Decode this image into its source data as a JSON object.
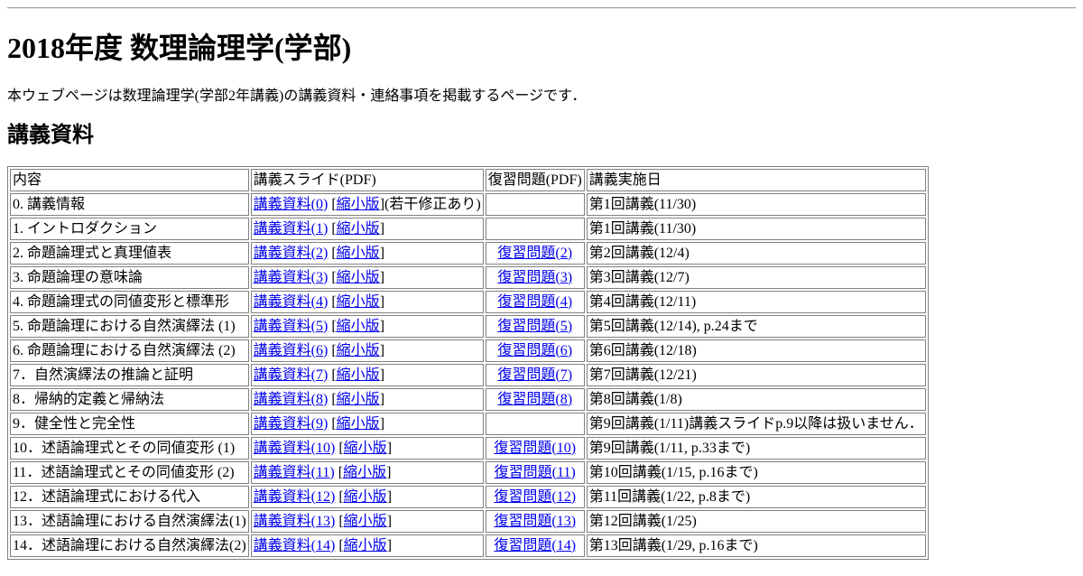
{
  "page": {
    "title": "2018年度 数理論理学(学部)",
    "intro": "本ウェブページは数理論理学(学部2年講義)の講義資料・連絡事項を掲載するページです．",
    "section_heading": "講義資料"
  },
  "table": {
    "headers": [
      "内容",
      "講義スライド(PDF)",
      "復習問題(PDF)",
      "講義実施日"
    ],
    "rows": [
      {
        "content": "0. 講義情報",
        "slide": "講義資料(0)",
        "small": "縮小版",
        "note": "(若干修正あり)",
        "review": "",
        "date": "第1回講義(11/30)"
      },
      {
        "content": "1. イントロダクション",
        "slide": "講義資料(1)",
        "small": "縮小版",
        "note": "",
        "review": "",
        "date": "第1回講義(11/30)"
      },
      {
        "content": "2. 命題論理式と真理値表",
        "slide": "講義資料(2)",
        "small": "縮小版",
        "note": "",
        "review": "復習問題(2)",
        "date": "第2回講義(12/4)"
      },
      {
        "content": "3. 命題論理の意味論",
        "slide": "講義資料(3)",
        "small": "縮小版",
        "note": "",
        "review": "復習問題(3)",
        "date": "第3回講義(12/7)"
      },
      {
        "content": "4. 命題論理式の同値変形と標準形",
        "slide": "講義資料(4)",
        "small": "縮小版",
        "note": "",
        "review": "復習問題(4)",
        "date": "第4回講義(12/11)"
      },
      {
        "content": "5. 命題論理における自然演繹法 (1)",
        "slide": "講義資料(5)",
        "small": "縮小版",
        "note": "",
        "review": "復習問題(5)",
        "date": "第5回講義(12/14), p.24まで"
      },
      {
        "content": "6. 命題論理における自然演繹法 (2)",
        "slide": "講義資料(6)",
        "small": "縮小版",
        "note": "",
        "review": "復習問題(6)",
        "date": "第6回講義(12/18)"
      },
      {
        "content": "7．自然演繹法の推論と証明",
        "slide": "講義資料(7)",
        "small": "縮小版",
        "note": "",
        "review": "復習問題(7)",
        "date": "第7回講義(12/21)"
      },
      {
        "content": "8．帰納的定義と帰納法",
        "slide": "講義資料(8)",
        "small": "縮小版",
        "note": "",
        "review": "復習問題(8)",
        "date": "第8回講義(1/8)"
      },
      {
        "content": "9．健全性と完全性",
        "slide": "講義資料(9)",
        "small": "縮小版",
        "note": "",
        "review": "",
        "date": "第9回講義(1/11)講義スライドp.9以降は扱いません．"
      },
      {
        "content": "10．述語論理式とその同値変形 (1)",
        "slide": "講義資料(10)",
        "small": "縮小版",
        "note": "",
        "review": "復習問題(10)",
        "date": "第9回講義(1/11, p.33まで)"
      },
      {
        "content": "11．述語論理式とその同値変形 (2)",
        "slide": "講義資料(11)",
        "small": "縮小版",
        "note": "",
        "review": "復習問題(11)",
        "date": "第10回講義(1/15, p.16まで)"
      },
      {
        "content": "12．述語論理式における代入",
        "slide": "講義資料(12)",
        "small": "縮小版",
        "note": "",
        "review": "復習問題(12)",
        "date": "第11回講義(1/22, p.8まで)"
      },
      {
        "content": "13．述語論理における自然演繹法(1)",
        "slide": "講義資料(13)",
        "small": "縮小版",
        "note": "",
        "review": "復習問題(13)",
        "date": "第12回講義(1/25)"
      },
      {
        "content": "14．述語論理における自然演繹法(2)",
        "slide": "講義資料(14)",
        "small": "縮小版",
        "note": "",
        "review": "復習問題(14)",
        "date": "第13回講義(1/29, p.16まで)"
      }
    ]
  }
}
